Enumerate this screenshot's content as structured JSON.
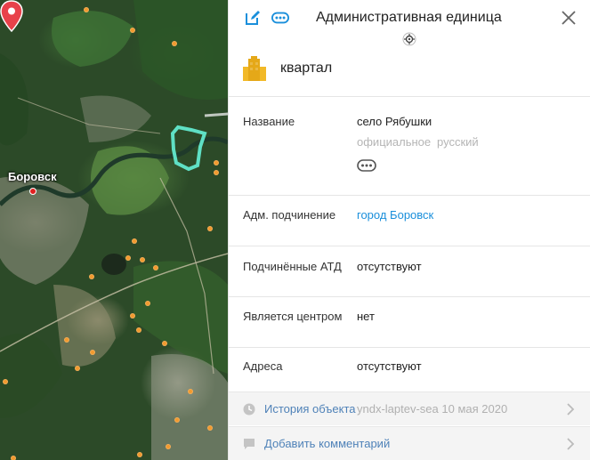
{
  "map": {
    "city_label": "Боровск"
  },
  "panel": {
    "title": "Административная единица",
    "type_label": "квартал",
    "fields": {
      "name": {
        "label": "Название",
        "value": "село Рябушки",
        "qualifier_official": "официальное",
        "qualifier_language": "русский"
      },
      "subordination": {
        "label": "Адм. подчинение",
        "value": "город Боровск"
      },
      "child_atd": {
        "label": "Подчинённые АТД",
        "value": "отсутствуют"
      },
      "is_center": {
        "label": "Является центром",
        "value": "нет"
      },
      "addresses": {
        "label": "Адреса",
        "value": "отсутствуют"
      }
    },
    "history": {
      "label": "История объекта",
      "author_date": "yndx-laptev-sea 10 мая 2020"
    },
    "comment": {
      "label": "Добавить комментарий"
    }
  },
  "colors": {
    "accent": "#1a8fdb",
    "link": "#4f82b8",
    "pin": "#e8414a",
    "highlight": "#5fe0c5",
    "poi": "#f29a2e"
  }
}
